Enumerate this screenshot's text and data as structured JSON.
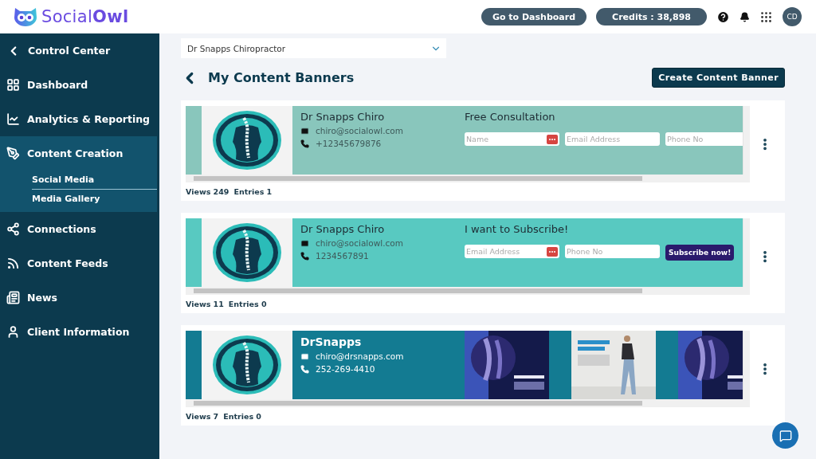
{
  "header": {
    "logo": "Social**Owl**",
    "dashboard_button": "Go to Dashboard",
    "credits": "Credits : 38,898",
    "avatar": "CD"
  },
  "sidebar": {
    "back": "Control Center",
    "items": [
      {
        "label": "Dashboard",
        "expanded": false
      },
      {
        "label": "Analytics & Reporting",
        "expanded": false
      },
      {
        "label": "Content Creation",
        "expanded": true,
        "children": [
          {
            "label": "Social Media",
            "selected": true
          },
          {
            "label": "Media Gallery",
            "selected": false
          }
        ]
      },
      {
        "label": "Connections",
        "expanded": false
      },
      {
        "label": "Content Feeds",
        "expanded": false
      },
      {
        "label": "News",
        "expanded": false
      },
      {
        "label": "Client Information",
        "expanded": false
      }
    ]
  },
  "client_select": {
    "value": "Dr Snapps Chiropractor"
  },
  "page_title": "My Content Banners",
  "create_button": "Create Content Banner",
  "banners": [
    {
      "kind": "form",
      "color": "#89c6bc",
      "name": "Dr Snapps Chiro",
      "email": "chiro@socialowl.com",
      "phone": "+12345679876",
      "form_title": "Free Consultation",
      "fields": [
        "Name",
        "Email Address",
        "Phone No"
      ],
      "views": "Views 249",
      "entries": "Entries 1"
    },
    {
      "kind": "form",
      "color": "#58c9c1",
      "name": "Dr Snapps Chiro",
      "email": "chiro@socialowl.com",
      "phone": "1234567891",
      "form_title": "I want to Subscribe!",
      "fields": [
        "Email Address",
        "Phone No"
      ],
      "button": "Subscribe now!",
      "views": "Views 11",
      "entries": "Entries 0"
    },
    {
      "kind": "pictures",
      "color": "#137b92",
      "name": "DrSnapps",
      "email": "chiro@drsnapps.com",
      "phone": "252-269-4410",
      "views": "Views 7",
      "entries": "Entries 0"
    }
  ]
}
